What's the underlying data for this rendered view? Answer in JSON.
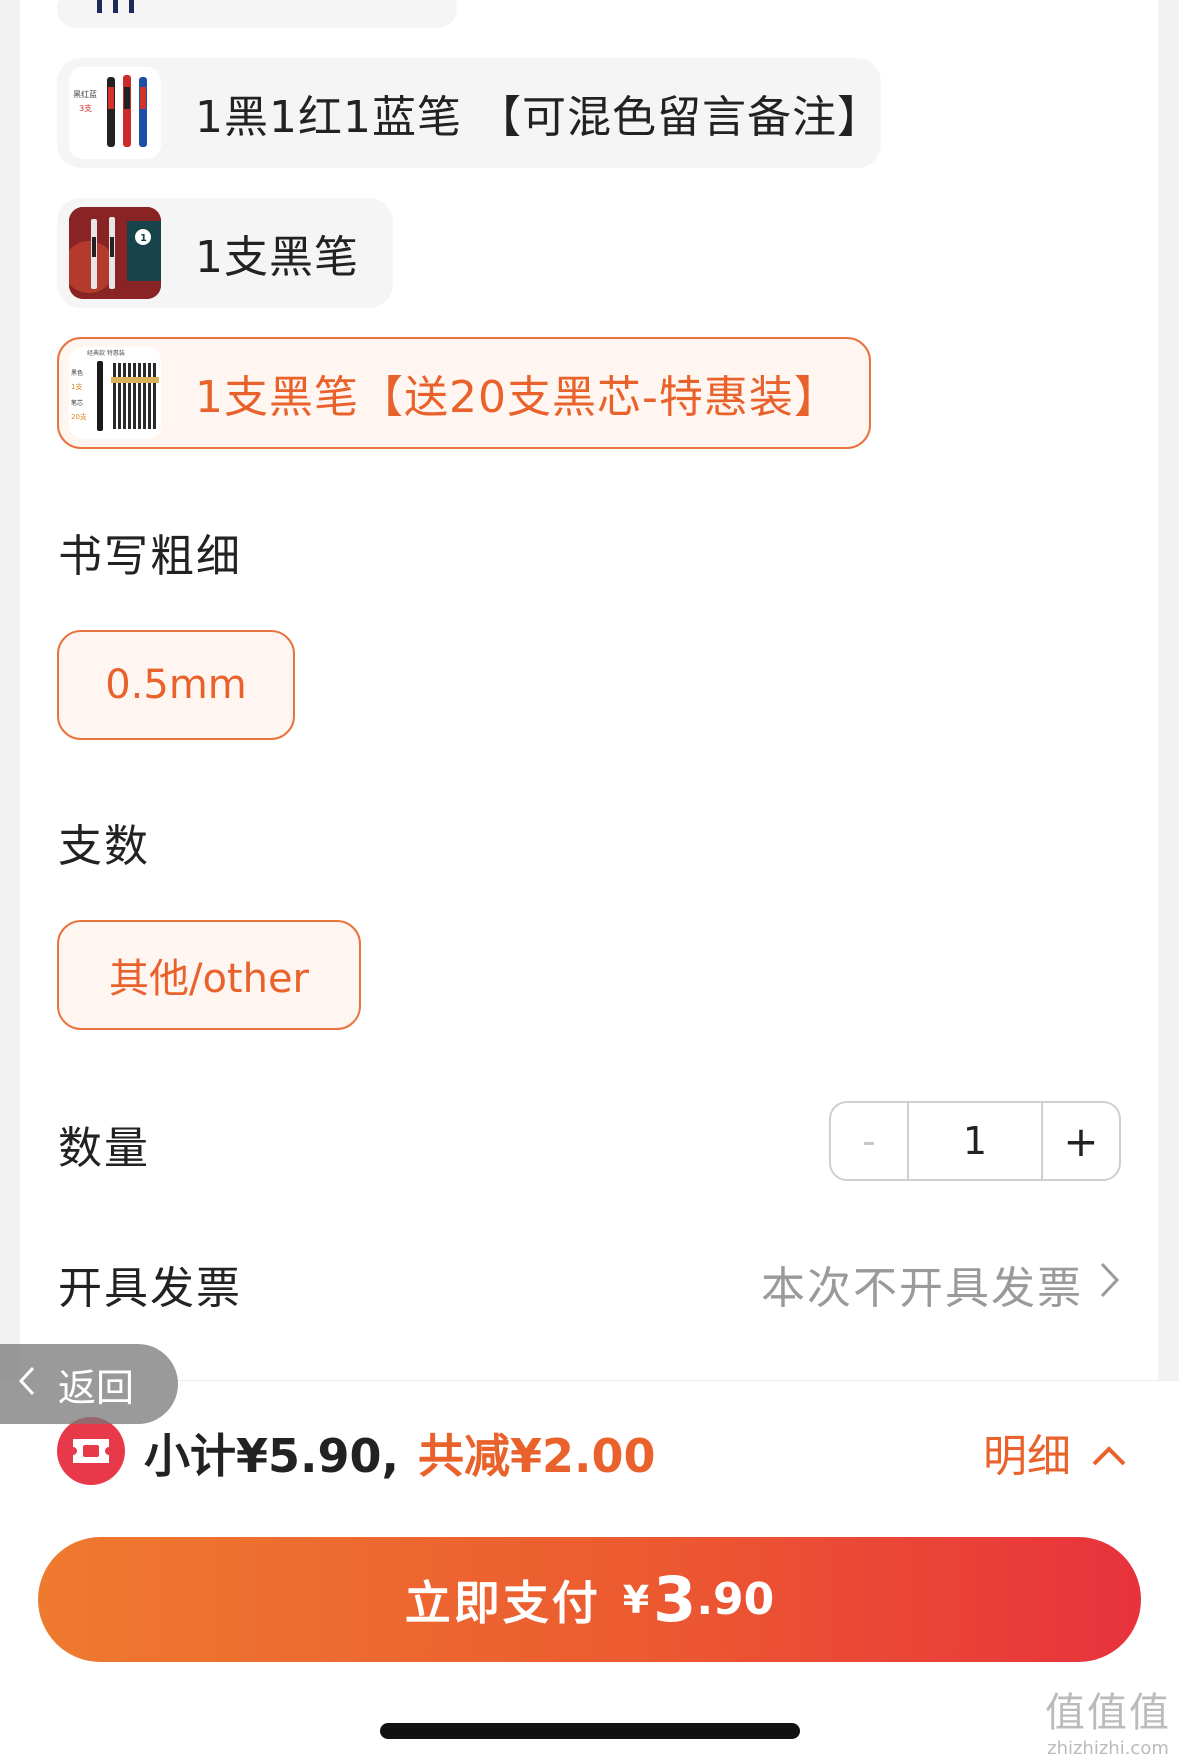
{
  "variants": [
    {
      "label": "1黑1红1蓝笔 【可混色留言备注】",
      "selected": false
    },
    {
      "label": "1支黑笔",
      "selected": false
    },
    {
      "label": "1支黑笔【送20支黑芯-特惠装】",
      "selected": true
    }
  ],
  "thumb_texts": {
    "mix_line1": "黑红蓝",
    "mix_line2": "3支",
    "refill_line1": "经典款  特惠装",
    "refill_line2": "黑色",
    "refill_line3": "1支",
    "refill_line4": "笔芯",
    "refill_line5": "20支"
  },
  "sections": {
    "thickness_title": "书写粗细",
    "thickness_option": "0.5mm",
    "count_title": "支数",
    "count_option": "其他/other",
    "quantity_title": "数量",
    "invoice_title": "开具发票"
  },
  "stepper": {
    "minus": "-",
    "value": "1",
    "plus": "+"
  },
  "invoice_value": "本次不开具发票",
  "back_label": "返回",
  "summary": {
    "subtotal": "小计¥5.90,",
    "saved": "共减¥2.00",
    "detail": "明细"
  },
  "pay": {
    "label": "立即支付",
    "currency": "¥",
    "amount_int": "3",
    "amount_dec": ".90"
  },
  "watermark": {
    "text": "值值值",
    "domain": "zhizhizhi.com"
  },
  "colors": {
    "accent": "#e9622b",
    "pay_start": "#ee7a2f",
    "pay_end": "#e8323d",
    "coupon": "#e8394b"
  }
}
